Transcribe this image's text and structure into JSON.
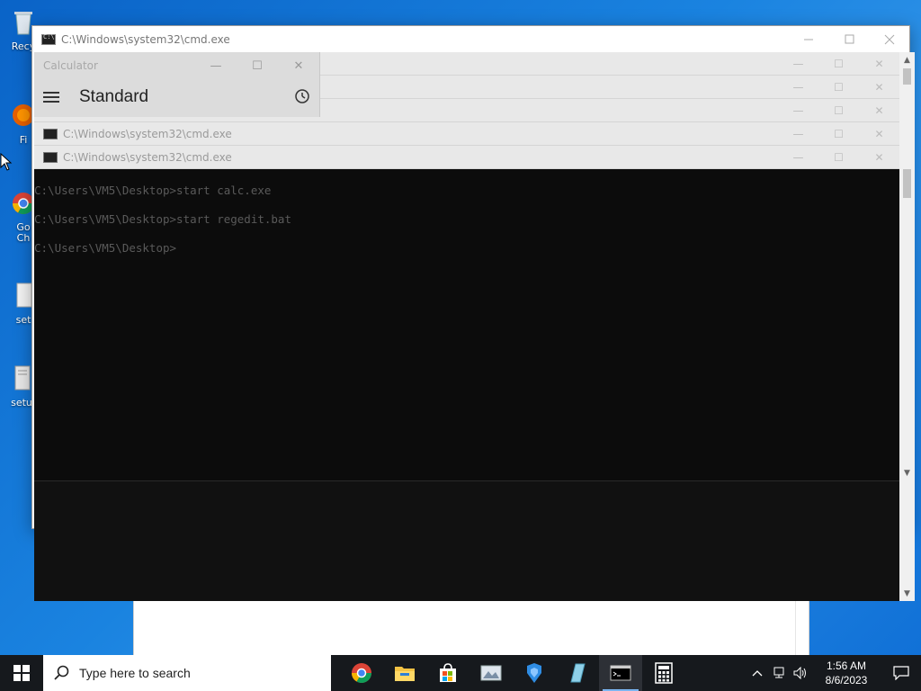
{
  "desktop": {
    "icons": [
      {
        "label": "Recy",
        "icon": "recycle-bin-icon"
      },
      {
        "label": "Fi",
        "icon": "firefox-icon"
      },
      {
        "label": "Go\nCh",
        "icon": "chrome-icon"
      },
      {
        "label": "set",
        "icon": "file-icon"
      },
      {
        "label": "setu",
        "icon": "file-icon"
      }
    ]
  },
  "cmd_back": {
    "title": "C:\\Windows\\system32\\cmd.exe"
  },
  "cmd_front": {
    "strips": [
      {
        "title": ""
      },
      {
        "title": ""
      },
      {
        "title": ""
      },
      {
        "title": "C:\\Windows\\system32\\cmd.exe"
      },
      {
        "title": "C:\\Windows\\system32\\cmd.exe"
      }
    ],
    "console_lines": [
      "C:\\Users\\VM5\\Desktop>start calc.exe",
      "C:\\Users\\VM5\\Desktop>start regedit.bat",
      "C:\\Users\\VM5\\Desktop>"
    ]
  },
  "calculator": {
    "title": "Calculator",
    "mode": "Standard"
  },
  "taskbar": {
    "search_placeholder": "Type here to search",
    "apps": [
      {
        "name": "chrome",
        "icon": "chrome-icon"
      },
      {
        "name": "file-explorer",
        "icon": "folder-icon"
      },
      {
        "name": "store",
        "icon": "store-icon"
      },
      {
        "name": "app-4",
        "icon": "image-app-icon"
      },
      {
        "name": "app-5",
        "icon": "blue-app-icon"
      },
      {
        "name": "app-6",
        "icon": "document-app-icon"
      },
      {
        "name": "cmd",
        "icon": "terminal-icon",
        "active": true
      },
      {
        "name": "calculator",
        "icon": "calculator-icon"
      }
    ],
    "clock_time": "1:56 AM",
    "clock_date": "8/6/2023"
  },
  "colors": {
    "desktop_blue": "#0a63c7",
    "taskbar": "#16191d",
    "console_bg": "#0c0c0c",
    "console_text": "#5a5a5a"
  }
}
